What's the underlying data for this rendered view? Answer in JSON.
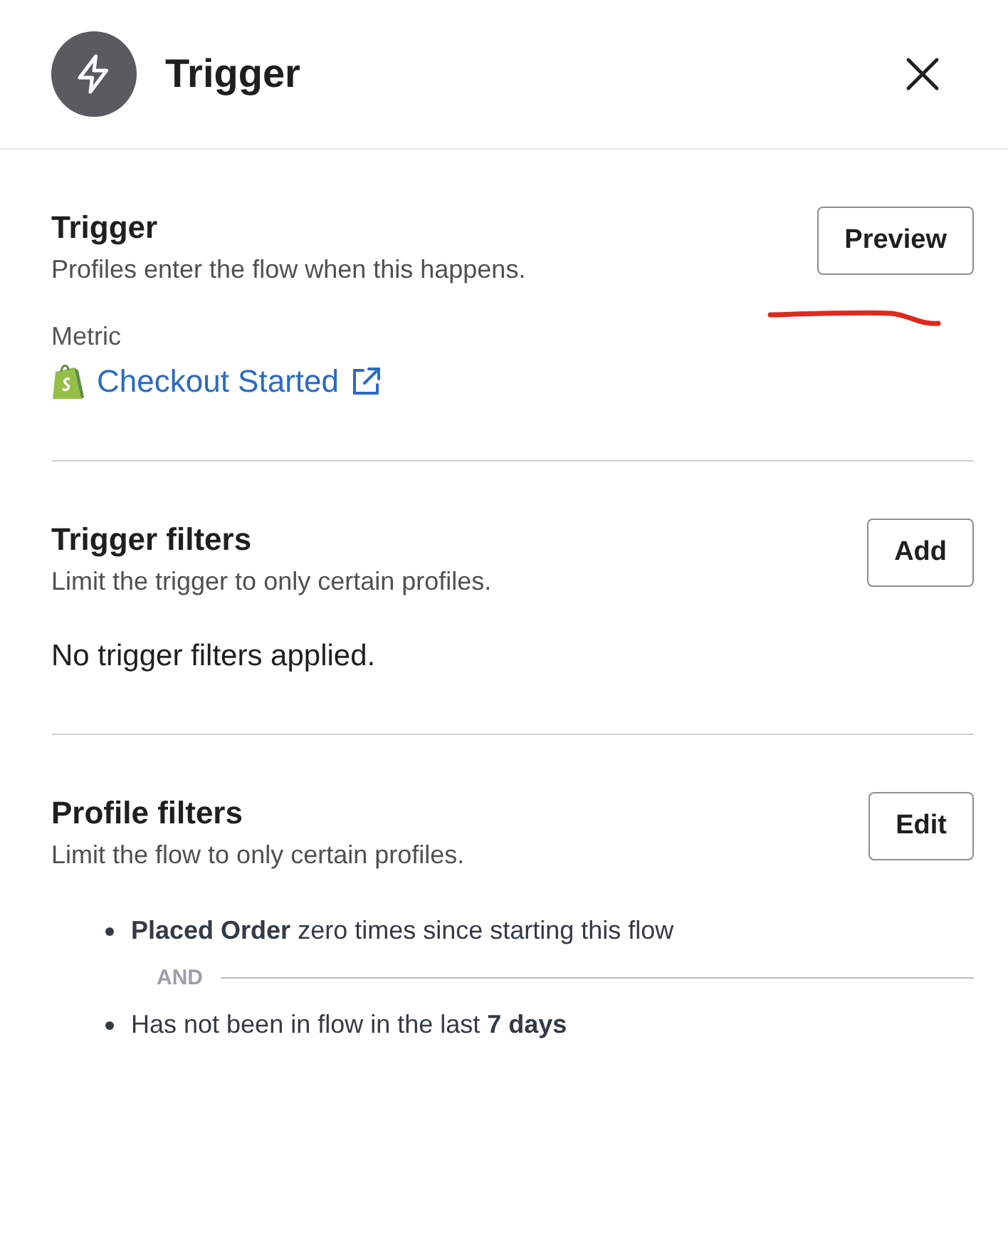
{
  "header": {
    "title": "Trigger"
  },
  "trigger": {
    "title": "Trigger",
    "description": "Profiles enter the flow when this happens.",
    "button": "Preview",
    "metric_label": "Metric",
    "metric": "Checkout Started"
  },
  "trigger_filters": {
    "title": "Trigger filters",
    "description": "Limit the trigger to only certain profiles.",
    "button": "Add",
    "empty_text": "No trigger filters applied."
  },
  "profile_filters": {
    "title": "Profile filters",
    "description": "Limit the flow to only certain profiles.",
    "button": "Edit",
    "conditions": [
      {
        "text": "**Placed Order** zero times since starting this flow"
      },
      {
        "text": "Has not been in flow in the last **7 days**"
      }
    ],
    "joiner": "AND"
  }
}
